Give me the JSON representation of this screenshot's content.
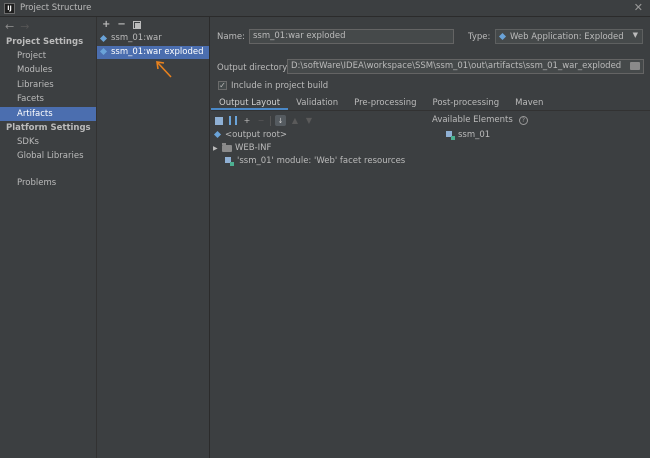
{
  "window": {
    "title": "Project Structure",
    "app_icon_text": "IJ"
  },
  "nav": {
    "back": "←",
    "forward": "→"
  },
  "sidebar": {
    "project_settings_header": "Project Settings",
    "project_items": [
      "Project",
      "Modules",
      "Libraries",
      "Facets",
      "Artifacts"
    ],
    "platform_settings_header": "Platform Settings",
    "platform_items": [
      "SDKs",
      "Global Libraries"
    ],
    "problems": "Problems",
    "selected": "Artifacts"
  },
  "artifacts": {
    "toolbar": {
      "add": "+",
      "remove": "−"
    },
    "items": [
      "ssm_01:war",
      "ssm_01:war exploded"
    ],
    "selected": "ssm_01:war exploded"
  },
  "details": {
    "name_label": "Name:",
    "name_value": "ssm_01:war exploded",
    "type_label": "Type:",
    "type_value": "Web Application: Exploded",
    "output_dir_label": "Output directory:",
    "output_dir_value": "D:\\softWare\\IDEA\\workspace\\SSM\\ssm_01\\out\\artifacts\\ssm_01_war_exploded",
    "include_label": "Include in project build",
    "include_checked": true,
    "tabs": [
      "Output Layout",
      "Validation",
      "Pre-processing",
      "Post-processing",
      "Maven"
    ],
    "active_tab": "Output Layout",
    "layout_toolbar": {
      "add": "+",
      "remove": "−",
      "sort": "↓"
    },
    "tree": {
      "root": "<output root>",
      "web_inf": "WEB-INF",
      "facet_resources": "'ssm_01' module: 'Web' facet resources"
    },
    "available_elements_label": "Available Elements",
    "available_items": [
      "ssm_01"
    ],
    "help_icon_text": "?"
  },
  "colors": {
    "selection": "#4b6eaf",
    "background": "#3c3f41",
    "accent_arrow": "#e8821e"
  }
}
